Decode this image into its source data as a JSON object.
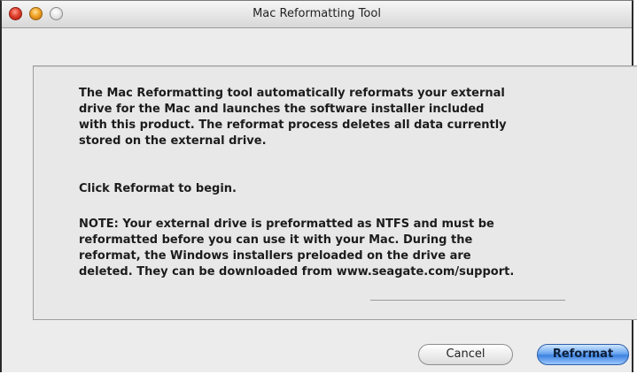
{
  "window": {
    "title": "Mac Reformatting Tool"
  },
  "message": {
    "paragraph1": "The Mac Reformatting tool automatically reformats your external\ndrive for the Mac and launches the software installer included\nwith this product. The reformat process deletes all data currently\nstored on the external drive.",
    "paragraph2": "Click Reformat to begin.",
    "paragraph3_text": "NOTE: Your external drive is preformatted as NTFS and must be\nreformatted before you can use it with your Mac. During the\nreformat, the Windows installers preloaded on the drive are\ndeleted. They can be downloaded from ",
    "paragraph3_link": "www.seagate.com/support."
  },
  "buttons": {
    "cancel_label": "Cancel",
    "reformat_label": "Reformat"
  },
  "colors": {
    "default_button": "#3c82e0",
    "close": "#e0412e",
    "minimize": "#f0a326"
  }
}
